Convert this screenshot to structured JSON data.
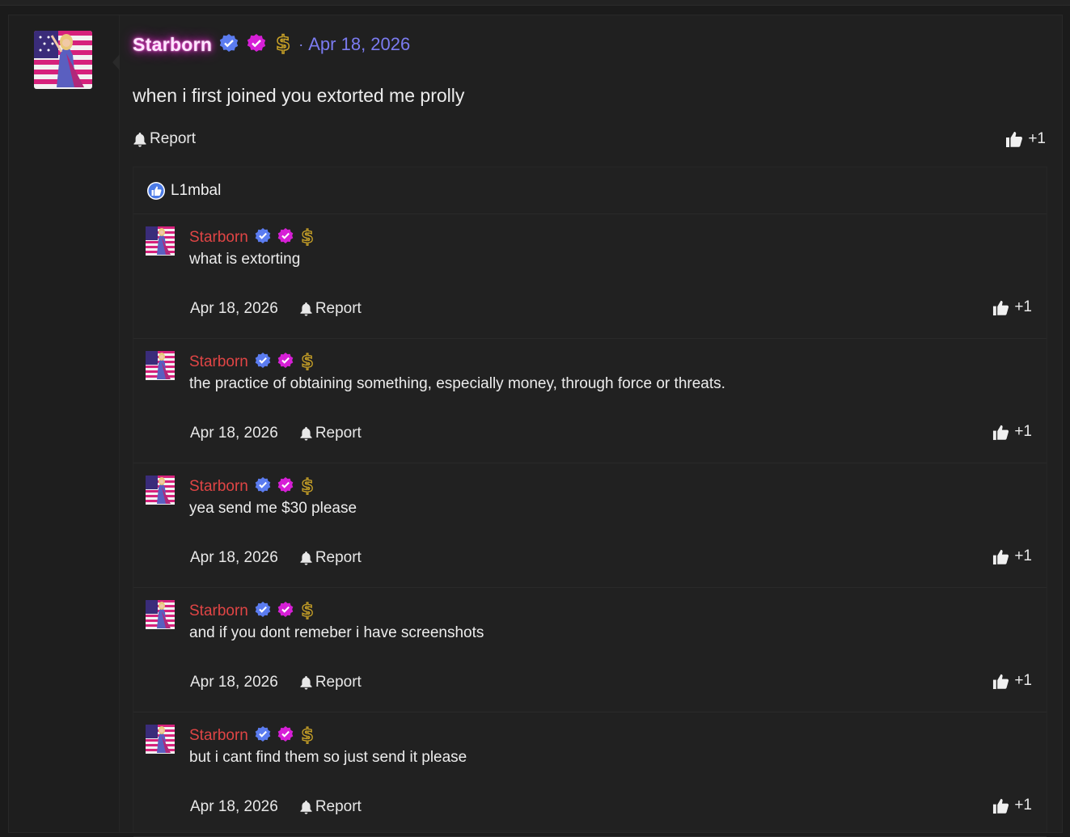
{
  "post": {
    "author": "Starborn",
    "date": "Apr 18, 2026",
    "body": "when i first joined you extorted me prolly",
    "report_label": "Report",
    "like_count": "+1"
  },
  "reactions": {
    "users": "L1mbal"
  },
  "comments": [
    {
      "author": "Starborn",
      "text": "what is extorting",
      "date": "Apr 18, 2026",
      "report_label": "Report",
      "like_count": "+1"
    },
    {
      "author": "Starborn",
      "text": "the practice of obtaining something, especially money, through force or threats.",
      "date": "Apr 18, 2026",
      "report_label": "Report",
      "like_count": "+1"
    },
    {
      "author": "Starborn",
      "text": "yea send me $30 please",
      "date": "Apr 18, 2026",
      "report_label": "Report",
      "like_count": "+1"
    },
    {
      "author": "Starborn",
      "text": "and if you dont remeber i have screenshots",
      "date": "Apr 18, 2026",
      "report_label": "Report",
      "like_count": "+1"
    },
    {
      "author": "Starborn",
      "text": "but i cant find them so just send it please",
      "date": "Apr 18, 2026",
      "report_label": "Report",
      "like_count": "+1"
    }
  ],
  "colors": {
    "background": "#1b1b1b",
    "card": "#202020",
    "comment_author": "#e04545",
    "post_date": "#7b7bf0",
    "verified_badge": "#5b7cf0",
    "pink_badge": "#d61fd6",
    "dollar_badge": "#c9a227"
  },
  "icons": [
    "verified-check-icon",
    "pink-check-icon",
    "dollar-icon",
    "bell-icon",
    "thumbs-up-icon",
    "like-reaction-icon"
  ]
}
